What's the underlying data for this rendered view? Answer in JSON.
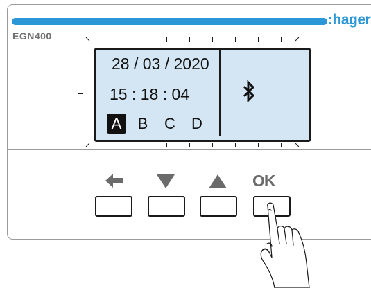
{
  "device": {
    "brand": ":hager",
    "model": "EGN400"
  },
  "display": {
    "date": "28 / 03 / 2020",
    "time": "15 : 18 : 04",
    "channels": [
      {
        "label": "A",
        "selected": true
      },
      {
        "label": "B",
        "selected": false
      },
      {
        "label": "C",
        "selected": false
      },
      {
        "label": "D",
        "selected": false
      }
    ],
    "status_icon": "bluetooth-icon"
  },
  "keys": {
    "back_icon": "arrow-left-icon",
    "down_icon": "triangle-down-icon",
    "up_icon": "triangle-up-icon",
    "ok_label": "OK"
  },
  "colors": {
    "brand_blue": "#2c97d6",
    "lcd_background": "#d4e6f4",
    "key_glyph_gray": "#6b6b6b"
  }
}
